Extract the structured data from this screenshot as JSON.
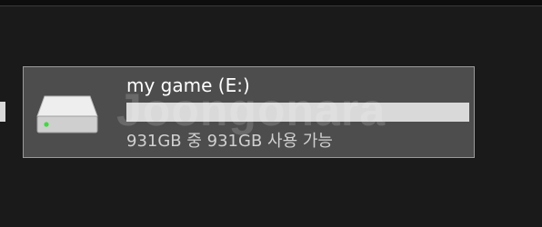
{
  "drive": {
    "name": "my game (E:)",
    "capacity_text": "931GB 중 931GB 사용 가능",
    "used_fraction": 0.0,
    "icon": "hard-drive-icon",
    "tile_background": "#4d4d4d",
    "tile_border": "#9a9a9a",
    "bar_background": "#d9d9d9",
    "bar_fill": "#26a0da",
    "activity_light": "#3ddc3d"
  },
  "watermark": {
    "text": "Joongonara"
  }
}
